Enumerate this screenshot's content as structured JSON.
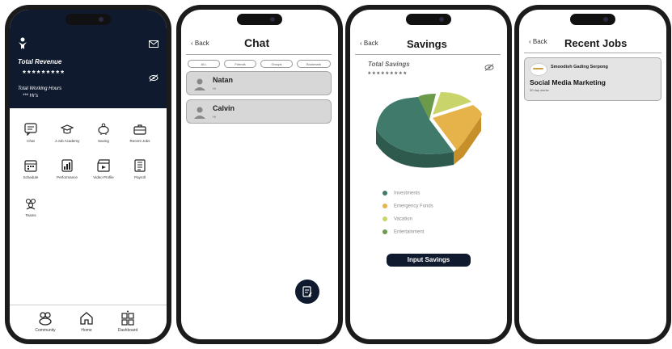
{
  "phone1": {
    "total_revenue_label": "Total Revenue",
    "revenue_masked": "*********",
    "working_hours_label": "Total Working Hours",
    "working_hours_masked": "*** Hr's",
    "grid": [
      {
        "label": "Chat",
        "icon": "chat-icon"
      },
      {
        "label": "J-Job Academy",
        "icon": "graduation-cap-icon"
      },
      {
        "label": "Saving",
        "icon": "piggy-bank-icon"
      },
      {
        "label": "Recent Jobs",
        "icon": "briefcase-icon"
      },
      {
        "label": "Schedule",
        "icon": "calendar-icon"
      },
      {
        "label": "Performance",
        "icon": "performance-icon"
      },
      {
        "label": "Video Profile",
        "icon": "video-icon"
      },
      {
        "label": "Payroll",
        "icon": "payroll-icon"
      },
      {
        "label": "Teams",
        "icon": "teams-icon"
      }
    ],
    "tabs": [
      {
        "label": "Community",
        "icon": "community-icon"
      },
      {
        "label": "Home",
        "icon": "home-icon"
      },
      {
        "label": "Dashboard",
        "icon": "dashboard-icon"
      }
    ]
  },
  "phone2": {
    "back_label": "Back",
    "title": "Chat",
    "filters": [
      "ALL",
      "Friends",
      "Groups",
      "Bookmark"
    ],
    "contacts": [
      {
        "name": "Natan",
        "message": "Hi"
      },
      {
        "name": "Calvin",
        "message": "Hi"
      }
    ]
  },
  "phone3": {
    "back_label": "Back",
    "title": "Savings",
    "total_savings_label": "Total Savings",
    "savings_masked": "*********",
    "legend": [
      {
        "label": "Investments",
        "color": "#3f7a6a"
      },
      {
        "label": "Emergency Funds",
        "color": "#e6b34a"
      },
      {
        "label": "Vacation",
        "color": "#c9d46a"
      },
      {
        "label": "Entertainment",
        "color": "#6a9a4a"
      }
    ],
    "button_label": "Input Savings"
  },
  "phone4": {
    "back_label": "Back",
    "title": "Recent Jobs",
    "job": {
      "company": "Smoodish Gading Serpong",
      "title": "Social Media Marketing",
      "meta": "30 day works"
    }
  }
}
